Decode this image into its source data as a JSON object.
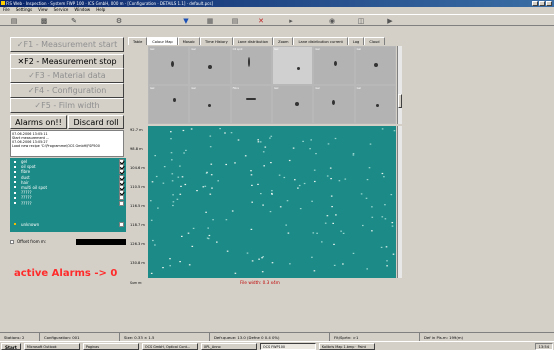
{
  "window": {
    "title": "FIS Web · Inspection · System FWP 100 · ICS GmbH, 000 m · [Configuration · DETAILS 1.1] · default.pcs]"
  },
  "menu": [
    "File",
    "Settings",
    "View",
    "Service",
    "Window",
    "Help"
  ],
  "toolbar": {
    "icons": [
      "folder-icon",
      "save-icon",
      "print-icon",
      "settings-icon",
      "filter-icon",
      "grid-icon",
      "list-icon",
      "delete-icon",
      "play-icon",
      "target-icon",
      "export-icon",
      "help-icon"
    ]
  },
  "function_buttons": [
    {
      "label": "✓F1 - Measurement start",
      "enabled": false
    },
    {
      "label": "✕F2 - Measurement stop",
      "enabled": true
    },
    {
      "label": "✓F3 - Material data",
      "enabled": false
    },
    {
      "label": "✓F4 - Configuration",
      "enabled": false
    },
    {
      "label": "✓F5 - Film width",
      "enabled": false
    }
  ],
  "alarms_button": "Alarms on!!",
  "discard_button": "Discard roll",
  "log": [
    "07.06.2006 13:05:11",
    "Start measurement ...",
    "07.06.2006 13:05:27",
    "Load new recipe 'C:\\Programme\\OCS GmbH\\FSP500"
  ],
  "defects": [
    {
      "name": "gel",
      "checked": true
    },
    {
      "name": "oil spot",
      "checked": true
    },
    {
      "name": "fibre",
      "checked": true
    },
    {
      "name": "dust",
      "checked": true
    },
    {
      "name": "hair",
      "checked": true
    },
    {
      "name": "multi oil spot",
      "checked": true
    },
    {
      "name": "?????",
      "checked": true
    },
    {
      "name": "?????",
      "checked": false
    },
    {
      "name": "?????",
      "checked": false
    },
    {
      "name": "unknown",
      "checked": false
    }
  ],
  "offset": {
    "label": "Offset from m:"
  },
  "alarm_status": "active Alarms -> 0",
  "tabs": [
    "Table",
    "Colour Map",
    "Mosaic",
    "Time History",
    "Lane distribution",
    "Zoom",
    "Lane distribution current",
    "Log",
    "Cloud"
  ],
  "active_tab": "Colour Map",
  "thumbnails": [
    "Gel",
    "Gel",
    "Oil spot",
    "Gel",
    "Gel",
    "Gel",
    "Gel",
    "Gel",
    "Fibre",
    "Gel",
    "Gel",
    "Gel"
  ],
  "map": {
    "ruler_labels": [
      "92.7 m",
      "98.8 m",
      "104.6 m",
      "110.5 m",
      "116.5 m",
      "118.7 m",
      "126.3 m",
      "130.8 m"
    ],
    "bottom_left": "Sum m:",
    "film_width": "File width:   0.3 x4m",
    "background": "#1c8a86"
  },
  "status_bar": [
    "Stations: 2",
    "Configuration: 001",
    "Size: 0.33 × 1.5",
    "Defr.queue: 13.0 (Defne 0 0.4 0%)",
    "Flt/Sprtn: >1",
    "Def in Pis.m: 199(m)"
  ],
  "taskbar": {
    "start": "Start",
    "tasks": [
      "Microsoft Outlook",
      "Paginas",
      "OCS GmbH, Optical Cont...",
      "XPL_Anno",
      "OCS FWP100",
      "Kolibris Map 1.bmp · Paint"
    ],
    "active_task": 4,
    "clock": "13:54"
  }
}
